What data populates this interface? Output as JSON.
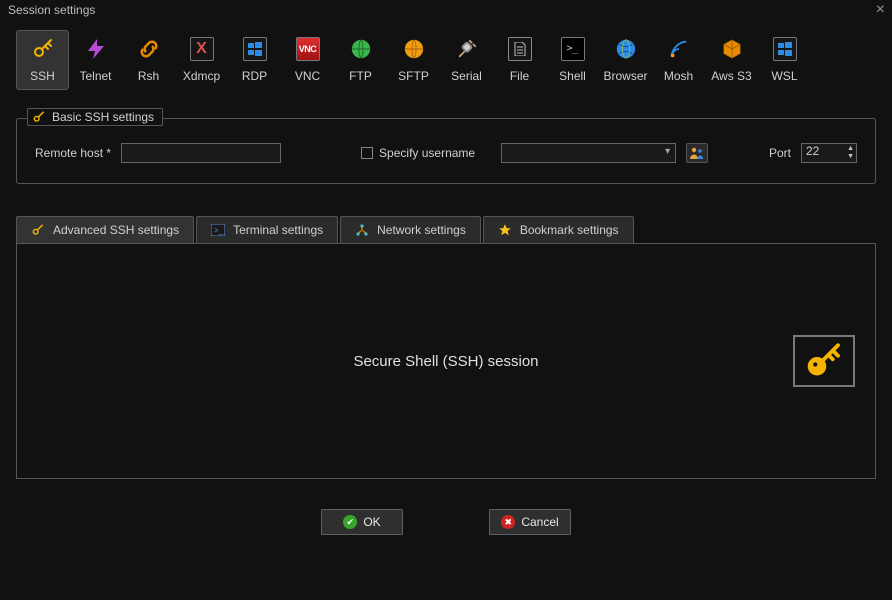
{
  "title": "Session settings",
  "protocols": [
    {
      "id": "ssh",
      "label": "SSH"
    },
    {
      "id": "telnet",
      "label": "Telnet"
    },
    {
      "id": "rsh",
      "label": "Rsh"
    },
    {
      "id": "xdmcp",
      "label": "Xdmcp"
    },
    {
      "id": "rdp",
      "label": "RDP"
    },
    {
      "id": "vnc",
      "label": "VNC"
    },
    {
      "id": "ftp",
      "label": "FTP"
    },
    {
      "id": "sftp",
      "label": "SFTP"
    },
    {
      "id": "serial",
      "label": "Serial"
    },
    {
      "id": "file",
      "label": "File"
    },
    {
      "id": "shell",
      "label": "Shell"
    },
    {
      "id": "browser",
      "label": "Browser"
    },
    {
      "id": "mosh",
      "label": "Mosh"
    },
    {
      "id": "awss3",
      "label": "Aws S3"
    },
    {
      "id": "wsl",
      "label": "WSL"
    }
  ],
  "basic": {
    "legend": "Basic SSH settings",
    "remote_host_label": "Remote host *",
    "remote_host_value": "",
    "specify_username_label": "Specify username",
    "specify_username_checked": false,
    "username_value": "",
    "port_label": "Port",
    "port_value": "22"
  },
  "tabs": {
    "advanced": "Advanced SSH settings",
    "terminal": "Terminal settings",
    "network": "Network settings",
    "bookmark": "Bookmark settings"
  },
  "panel": {
    "description": "Secure Shell (SSH) session"
  },
  "buttons": {
    "ok": "OK",
    "cancel": "Cancel"
  }
}
